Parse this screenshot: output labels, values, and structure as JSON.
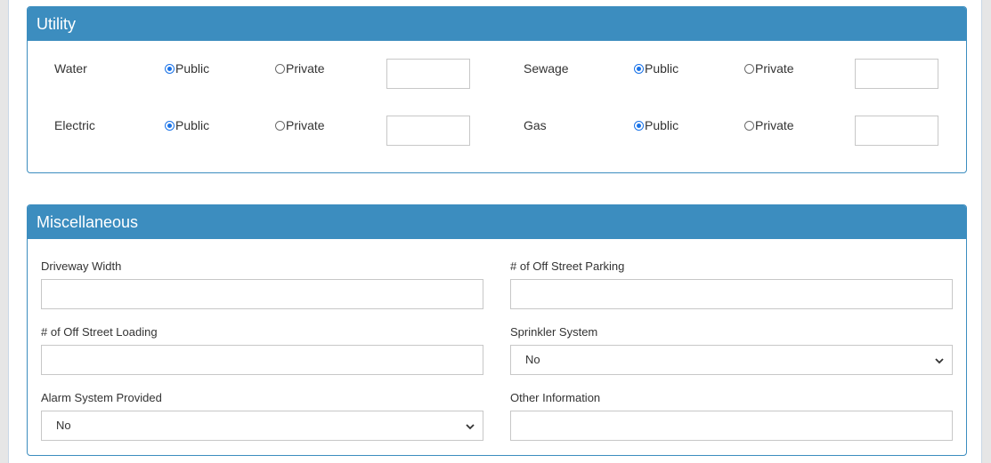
{
  "utility": {
    "title": "Utility",
    "rows": [
      {
        "label": "Water",
        "option_public": "Public",
        "option_private": "Private",
        "selected": "Public",
        "value": ""
      },
      {
        "label": "Sewage",
        "option_public": "Public",
        "option_private": "Private",
        "selected": "Public",
        "value": ""
      },
      {
        "label": "Electric",
        "option_public": "Public",
        "option_private": "Private",
        "selected": "Public",
        "value": ""
      },
      {
        "label": "Gas",
        "option_public": "Public",
        "option_private": "Private",
        "selected": "Public",
        "value": ""
      }
    ]
  },
  "miscellaneous": {
    "title": "Miscellaneous",
    "driveway_width": {
      "label": "Driveway Width",
      "value": ""
    },
    "off_street_parking": {
      "label": "# of Off Street Parking",
      "value": ""
    },
    "off_street_loading": {
      "label": "# of Off Street Loading",
      "value": ""
    },
    "sprinkler_system": {
      "label": "Sprinkler System",
      "value": "No"
    },
    "alarm_system": {
      "label": "Alarm System Provided",
      "value": "No"
    },
    "other_information": {
      "label": "Other Information",
      "value": ""
    }
  },
  "colors": {
    "panel_header": "#3c8dbf",
    "radio_selected": "#1a73e8"
  },
  "icons": {
    "select_arrow": "chevron-down-icon"
  }
}
